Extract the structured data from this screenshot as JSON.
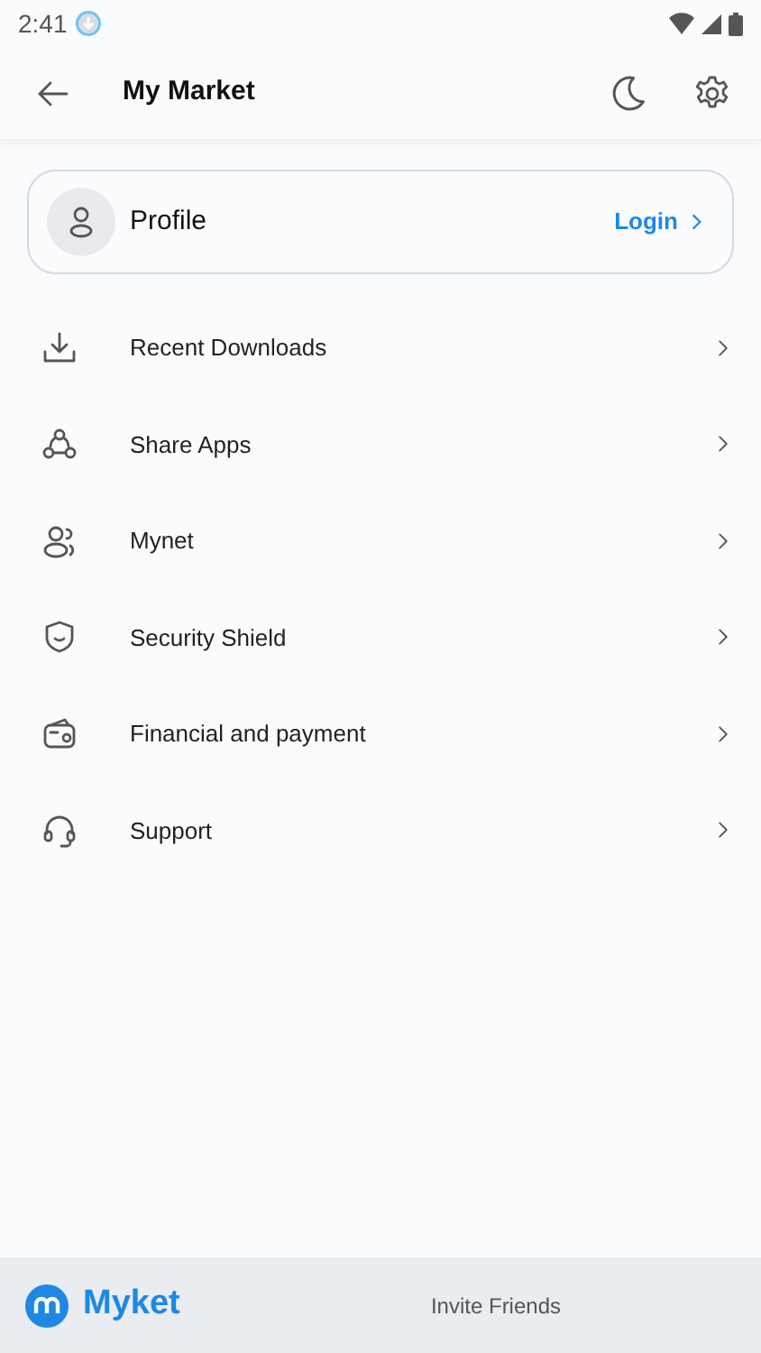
{
  "status_bar": {
    "time": "2:41"
  },
  "header": {
    "title": "My Market"
  },
  "profile": {
    "name": "Profile",
    "action": "Login"
  },
  "menu_items": [
    {
      "kind": "download",
      "label": "Recent Downloads"
    },
    {
      "kind": "share",
      "label": "Share Apps"
    },
    {
      "kind": "people",
      "label": "Mynet"
    },
    {
      "kind": "shield",
      "label": "Security Shield"
    },
    {
      "kind": "wallet",
      "label": "Financial and payment"
    },
    {
      "kind": "headset",
      "label": "Support"
    }
  ],
  "footer": {
    "brand": "Myket",
    "invite": "Invite Friends"
  }
}
